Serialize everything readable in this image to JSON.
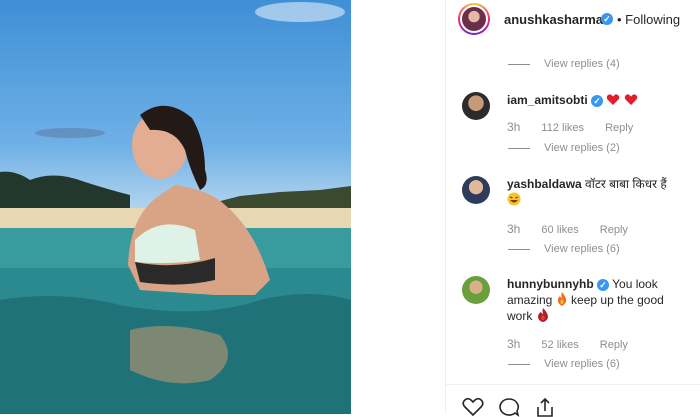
{
  "header": {
    "username": "anushkasharma",
    "verified_mark": "✓",
    "follow_label": "• Following"
  },
  "top_view_replies": "View replies (4)",
  "comments": [
    {
      "username": "iam_amitsobti",
      "verified": true,
      "text": "",
      "emojis": [
        "heart",
        "heart"
      ],
      "time": "3h",
      "likes": "112 likes",
      "reply_label": "Reply",
      "view_replies": "View replies (2)"
    },
    {
      "username": "yashbaldawa",
      "verified": false,
      "text": "वॉटर बाबा किधर हैं",
      "emojis": [
        "laughing-face"
      ],
      "time": "3h",
      "likes": "60 likes",
      "reply_label": "Reply",
      "view_replies": "View replies (6)"
    },
    {
      "username": "hunnybunnyhb",
      "verified": true,
      "text_part1": "You look amazing",
      "text_part2": "keep up the good work",
      "emojis": [
        "fire",
        "fire"
      ],
      "time": "3h",
      "likes": "52 likes",
      "reply_label": "Reply",
      "view_replies": "View replies (6)"
    }
  ],
  "footer_icons": [
    "heart-outline-icon",
    "comment-icon",
    "share-icon"
  ]
}
